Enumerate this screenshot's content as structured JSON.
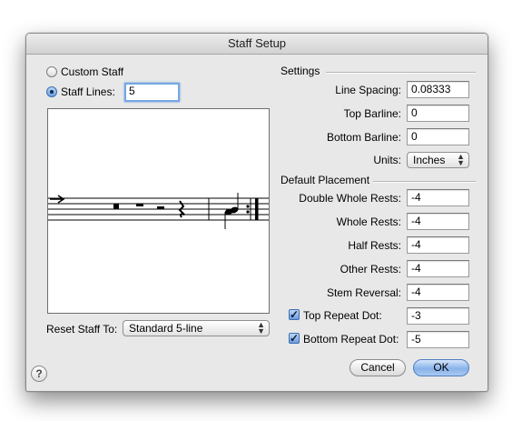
{
  "window": {
    "title": "Staff Setup"
  },
  "staff_type": {
    "custom_label": "Custom Staff",
    "lines_label": "Staff Lines:",
    "lines_value": "5",
    "selected": "staff_lines"
  },
  "reset": {
    "label": "Reset Staff To:",
    "value": "Standard 5-line"
  },
  "settings": {
    "title": "Settings",
    "line_spacing": {
      "label": "Line Spacing:",
      "value": "0.08333"
    },
    "top_barline": {
      "label": "Top Barline:",
      "value": "0"
    },
    "bottom_barline": {
      "label": "Bottom Barline:",
      "value": "0"
    },
    "units": {
      "label": "Units:",
      "value": "Inches"
    }
  },
  "placement": {
    "title": "Default Placement",
    "double_whole": {
      "label": "Double Whole Rests:",
      "value": "-4"
    },
    "whole": {
      "label": "Whole Rests:",
      "value": "-4"
    },
    "half": {
      "label": "Half Rests:",
      "value": "-4"
    },
    "other": {
      "label": "Other Rests:",
      "value": "-4"
    },
    "stem_reversal": {
      "label": "Stem Reversal:",
      "value": "-4"
    },
    "top_repeat_dot": {
      "label": "Top Repeat Dot:",
      "value": "-3",
      "checked": true
    },
    "bottom_repeat_dot": {
      "label": "Bottom Repeat Dot:",
      "value": "-5",
      "checked": true
    }
  },
  "buttons": {
    "cancel": "Cancel",
    "ok": "OK",
    "help": "?"
  },
  "icons": {
    "check": "✓",
    "popup_arrows_up": "▲",
    "popup_arrows_down": "▼"
  },
  "colors": {
    "accent": "#76a6e4",
    "default_button": "#88b2ea"
  }
}
